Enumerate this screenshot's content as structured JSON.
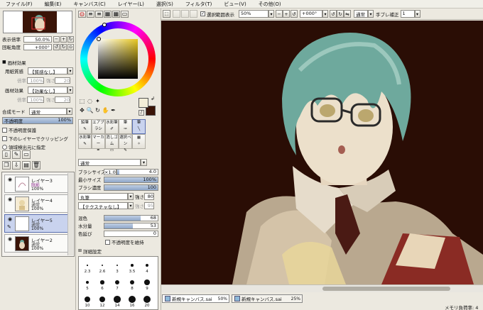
{
  "menus": [
    "ファイル(F)",
    "編集(E)",
    "キャンバス(C)",
    "レイヤー(L)",
    "選択(S)",
    "フィルタ(T)",
    "ビュー(V)",
    "その他(O)"
  ],
  "navigator": {
    "zoom_label": "表示倍率",
    "zoom_value": "50.0%",
    "angle_label": "回転角度",
    "angle_value": "+000°"
  },
  "texture": {
    "header": "画材効果",
    "paper_label": "用紙質感",
    "paper_value": "【質感なし】",
    "paper_scale": "100%",
    "paper_strength": "20",
    "effect_label": "画材効果",
    "effect_value": "【効果なし】",
    "effect_scale": "100%",
    "effect_strength": "20"
  },
  "blend": {
    "label": "合成モード",
    "value": "通常",
    "opacity_label": "不透明度",
    "opacity_value": "100%",
    "opacity_pct": 100,
    "options": [
      "不透明度保護",
      "下のレイヤーでクリッピング",
      "領域検出元に指定"
    ]
  },
  "layers": [
    {
      "name": "レイヤー3",
      "mode": "陰影",
      "opacity": "100%",
      "mode_color": "#8a2b8a"
    },
    {
      "name": "レイヤー4",
      "mode": "通常",
      "opacity": "100%",
      "mode_color": "#222"
    },
    {
      "name": "レイヤー5",
      "mode": "通常",
      "opacity": "100%",
      "mode_color": "#222"
    },
    {
      "name": "レイヤー2",
      "mode": "通常",
      "opacity": "100%",
      "mode_color": "#222"
    }
  ],
  "tools": [
    [
      "鉛筆",
      "エアブラシ",
      "筆",
      "水彩筆"
    ],
    [
      "水彩筆",
      "マーカー",
      "消しゴム",
      "選択ペン"
    ],
    [
      "選択消し",
      "バケツ",
      "2値ペン",
      "色塗り"
    ]
  ],
  "brush": {
    "mode": "通常",
    "size_label": "ブラシサイズ",
    "size_mult": "×1.0",
    "size_value": "4.0",
    "min_label": "最小サイズ",
    "min_value": "100%",
    "min_pct": 100,
    "density_label": "ブラシ濃度",
    "density_value": "100",
    "density_pct": 100,
    "shape": "丸筆",
    "shape_strength_label": "強さ",
    "shape_strength": "80",
    "tex": "【テクスチャなし】",
    "tex_strength_label": "強さ",
    "tex_strength": "95",
    "mix_label": "混色",
    "mix_value": "68",
    "mix_pct": 68,
    "water_label": "水分量",
    "water_value": "53",
    "water_pct": 53,
    "stretch_label": "色延び",
    "stretch_value": "0",
    "stretch_pct": 0,
    "keep_opacity": "不透明度を維持",
    "detail": "詳細設定"
  },
  "brush_sizes": [
    "2.3",
    "2.6",
    "3",
    "3.5",
    "4",
    "5",
    "6",
    "7",
    "8",
    "9",
    "10",
    "12",
    "14",
    "16",
    "20"
  ],
  "toolbar": {
    "selection_label": "選択範囲表示",
    "zoom": "50%",
    "angle": "+000°",
    "mode": "通常",
    "stabilizer_label": "手ブレ補正",
    "stabilizer": "1"
  },
  "tabs": [
    {
      "name": "新規キャンバス.sai",
      "zoom": "50%"
    },
    {
      "name": "新規キャンバス.sai",
      "zoom": "25%"
    }
  ],
  "status": "メモリ負荷率: 4",
  "colors": {
    "primary": "#f4eed8",
    "secondary": "#3a1408",
    "canvas": "#2a0d05",
    "accent": "#5a6fb0"
  }
}
